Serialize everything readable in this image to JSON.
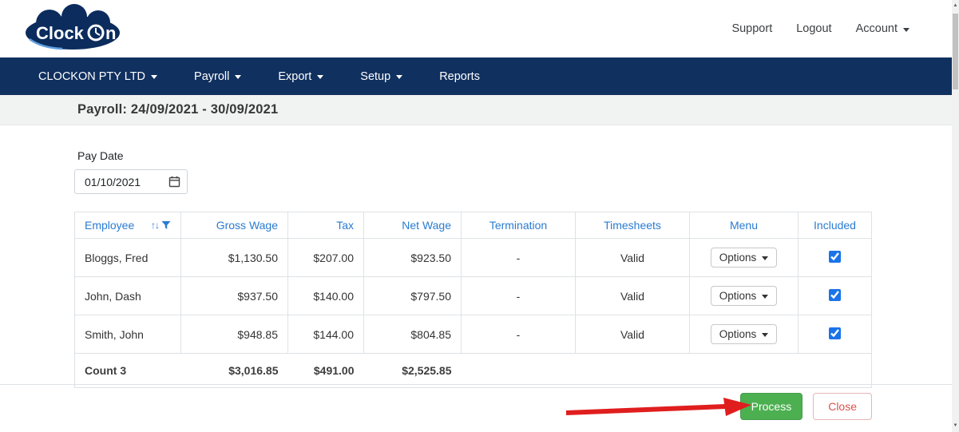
{
  "header": {
    "logo": {
      "part1": "Clock",
      "part2": "n",
      "full": "ClockOn"
    },
    "support": "Support",
    "logout": "Logout",
    "account": "Account"
  },
  "nav": {
    "company": "CLOCKON PTY LTD",
    "payroll": "Payroll",
    "export": "Export",
    "setup": "Setup",
    "reports": "Reports"
  },
  "page": {
    "title": "Payroll: 24/09/2021 - 30/09/2021"
  },
  "form": {
    "pay_date_label": "Pay Date",
    "pay_date_value": "01/10/2021"
  },
  "table": {
    "columns": [
      "Employee",
      "Gross Wage",
      "Tax",
      "Net Wage",
      "Termination",
      "Timesheets",
      "Menu",
      "Included"
    ],
    "rows": [
      {
        "employee": "Bloggs, Fred",
        "gross": "$1,130.50",
        "tax": "$207.00",
        "net": "$923.50",
        "termination": "-",
        "timesheets": "Valid",
        "menu": "Options",
        "included": true
      },
      {
        "employee": "John, Dash",
        "gross": "$937.50",
        "tax": "$140.00",
        "net": "$797.50",
        "termination": "-",
        "timesheets": "Valid",
        "menu": "Options",
        "included": true
      },
      {
        "employee": "Smith, John",
        "gross": "$948.85",
        "tax": "$144.00",
        "net": "$804.85",
        "termination": "-",
        "timesheets": "Valid",
        "menu": "Options",
        "included": true
      }
    ],
    "footer": {
      "count_label": "Count 3",
      "gross": "$3,016.85",
      "tax": "$491.00",
      "net": "$2,525.85"
    }
  },
  "actions": {
    "process": "Process",
    "close": "Close"
  },
  "icons": {
    "sort_arrows": "↑↓",
    "scroll_up": "▲",
    "scroll_down": "▼"
  },
  "colors": {
    "navbar": "#10305f",
    "table_header_blue": "#2a7bd2",
    "process_green": "#4caf50",
    "close_red": "#d9534f",
    "arrow_red": "#e01e1e"
  }
}
